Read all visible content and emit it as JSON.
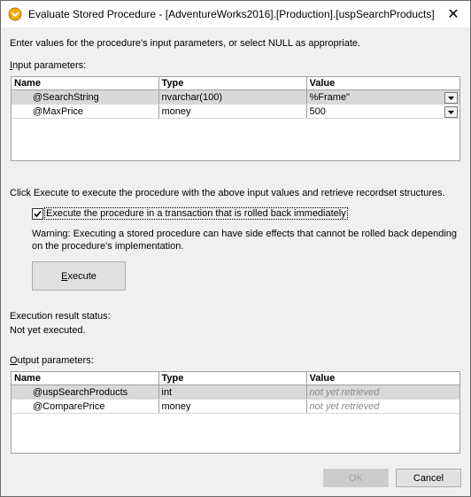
{
  "window": {
    "title": "Evaluate Stored Procedure - [AdventureWorks2016].[Production].[uspSearchProducts]"
  },
  "intro_text": "Enter values for the procedure's input parameters, or select NULL as appropriate.",
  "input_params": {
    "label": "Input parameters:",
    "columns": [
      "Name",
      "Type",
      "Value"
    ],
    "rows": [
      {
        "name": "@SearchString",
        "type": "nvarchar(100)",
        "value": "%Frame\""
      },
      {
        "name": "@MaxPrice",
        "type": "money",
        "value": "500"
      }
    ]
  },
  "execute_info": "Click Execute to execute the procedure with the above input values and retrieve recordset structures.",
  "rollback_checkbox": {
    "label": "Execute the procedure in a transaction that is rolled back immediately",
    "checked": true
  },
  "warning_line1": "Warning: Executing a stored procedure can have side effects that cannot be rolled back depending",
  "warning_line2": "on the procedure's implementation.",
  "execute_button": "Execute",
  "result_status": {
    "label": "Execution result status:",
    "value": "Not yet executed."
  },
  "output_params": {
    "label": "Output parameters:",
    "columns": [
      "Name",
      "Type",
      "Value"
    ],
    "rows": [
      {
        "name": "@uspSearchProducts",
        "type": "int",
        "value": "not yet retrieved"
      },
      {
        "name": "@ComparePrice",
        "type": "money",
        "value": "not yet retrieved"
      }
    ]
  },
  "buttons": {
    "ok": "OK",
    "cancel": "Cancel"
  },
  "icons": {
    "app": "altova-mapforce-icon",
    "close": "close-icon",
    "dropdown": "chevron-down-icon"
  }
}
